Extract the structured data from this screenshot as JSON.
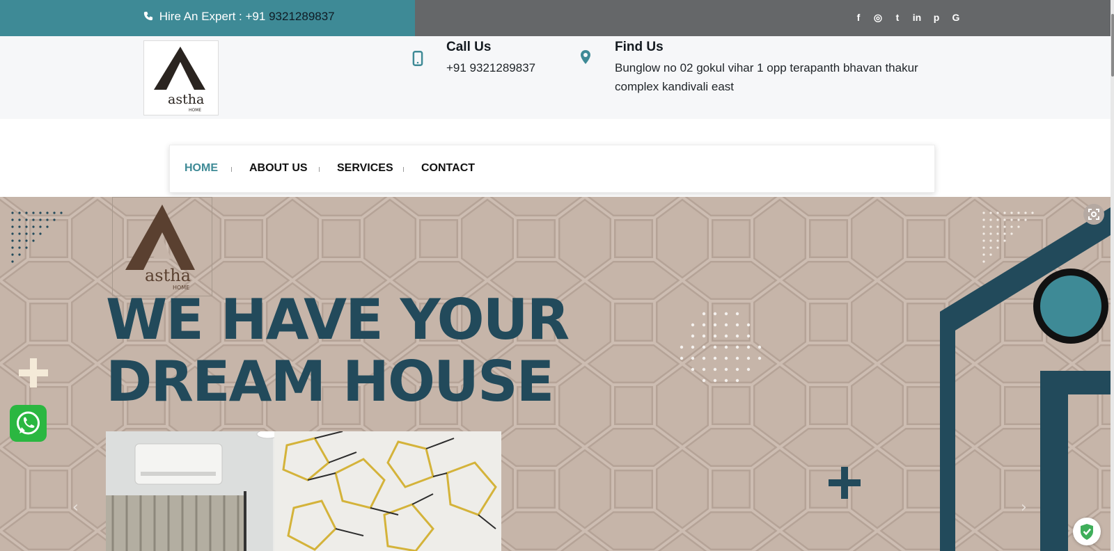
{
  "topbar": {
    "hire_label": "Hire An Expert : +91",
    "hire_number": "9321289837",
    "social_icons": [
      "facebook-icon",
      "instagram-icon",
      "twitter-icon",
      "linkedin-icon",
      "pinterest-icon",
      "google-icon"
    ],
    "social_glyphs": [
      "f",
      "◎",
      "t",
      "in",
      "p",
      "G"
    ],
    "accent_color": "#3e8a96",
    "bar_color": "#656769"
  },
  "header": {
    "call_title": "Call Us",
    "call_number": "+91 9321289837",
    "find_title": "Find Us",
    "find_address": "Bunglow no 02 gokul vihar 1 opp terapanth bhavan thakur complex kandivali east",
    "logo_text": "astha",
    "logo_sub": "HOME"
  },
  "nav": {
    "items": [
      {
        "label": "HOME",
        "active": true
      },
      {
        "label": "ABOUT US",
        "active": false
      },
      {
        "label": "SERVICES",
        "active": false
      },
      {
        "label": "CONTACT",
        "active": false
      }
    ]
  },
  "hero": {
    "title_line1": "WE HAVE YOUR",
    "title_line2": "DREAM HOUSE",
    "logo_text": "astha",
    "logo_sub": "HOME",
    "prev_arrow": "‹",
    "next_arrow": "›",
    "title_color": "#224a5b",
    "background_color": "#c6b5a9"
  }
}
